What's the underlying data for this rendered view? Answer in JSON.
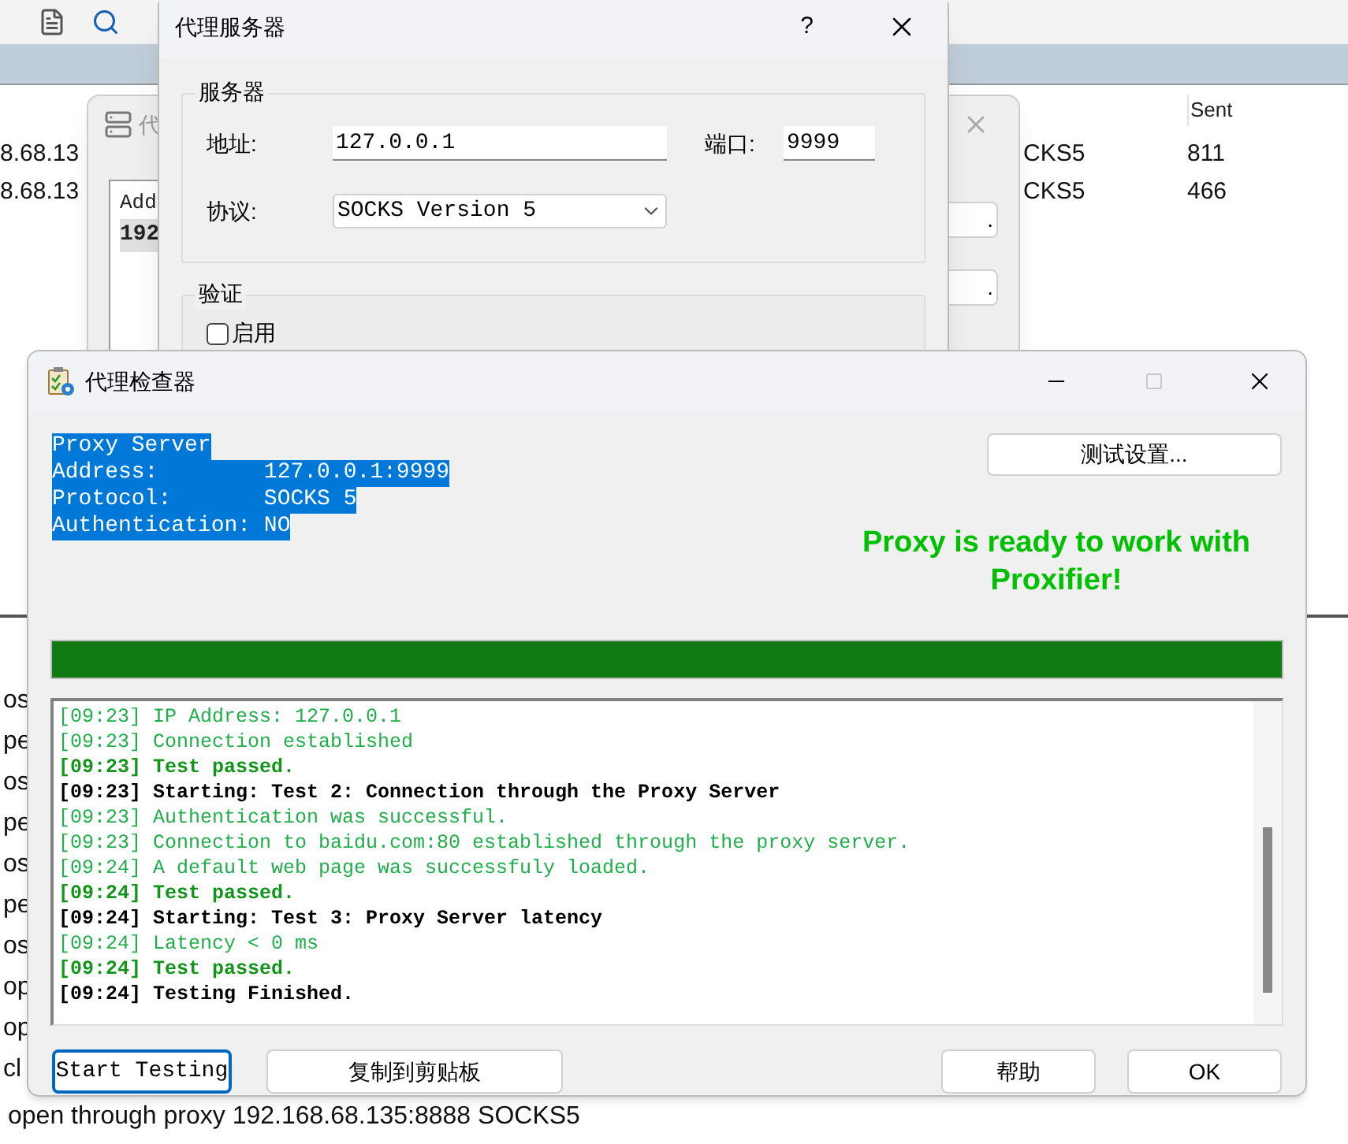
{
  "background_app": {
    "table": {
      "columns": [
        {
          "label": "Sent"
        }
      ],
      "rows": [
        {
          "address": "8.68.13",
          "protocol": "CKS5",
          "sent": "811"
        },
        {
          "address": "8.68.13",
          "protocol": "CKS5",
          "sent": "466"
        }
      ]
    },
    "log_fragments": [
      "os",
      "pe",
      "os",
      "pe",
      "os",
      "pe",
      "os",
      "op",
      "op",
      "cl"
    ],
    "log_last_line": "open through proxy 192.168.68.135:8888 SOCKS5"
  },
  "behind_window": {
    "title": "代",
    "list_lines": [
      "Add",
      "192"
    ],
    "buttons": [
      ".",
      "."
    ]
  },
  "proxy_server_dialog": {
    "title": "代理服务器",
    "help": "?",
    "server_group": {
      "title": "服务器",
      "address_label": "地址:",
      "address": "127.0.0.1",
      "port_label": "端口:",
      "port": "9999",
      "protocol_label": "协议:",
      "protocol": "SOCKS Version 5"
    },
    "auth_group": {
      "title": "验证",
      "enable_label": "启用",
      "enabled": false
    }
  },
  "checker": {
    "title": "代理检查器",
    "summary": {
      "selected": true,
      "lines": [
        "Proxy Server",
        "Address:        127.0.0.1:9999",
        "Protocol:       SOCKS 5",
        "Authentication: NO"
      ]
    },
    "settings_button": "测试设置...",
    "status": "Proxy is ready to work with Proxifier!",
    "progress": {
      "level": 1
    },
    "log": [
      {
        "time": "[09:23]",
        "text": "IP Address: 127.0.0.1",
        "kind": "info"
      },
      {
        "time": "[09:23]",
        "text": "Connection established",
        "kind": "info"
      },
      {
        "time": "[09:23]",
        "text": "Test passed.",
        "kind": "success"
      },
      {
        "time": "[09:23]",
        "text": "Starting: Test 2: Connection through the Proxy Server",
        "kind": "step"
      },
      {
        "time": "[09:23]",
        "text": "Authentication was successful.",
        "kind": "info"
      },
      {
        "time": "[09:23]",
        "text": "Connection to baidu.com:80 established through the proxy server.",
        "kind": "info"
      },
      {
        "time": "[09:24]",
        "text": "A default web page was successfuly loaded.",
        "kind": "info"
      },
      {
        "time": "[09:24]",
        "text": "Test passed.",
        "kind": "success"
      },
      {
        "time": "[09:24]",
        "text": "Starting: Test 3: Proxy Server latency",
        "kind": "step"
      },
      {
        "time": "[09:24]",
        "text": "Latency < 0 ms",
        "kind": "info"
      },
      {
        "time": "[09:24]",
        "text": "Test passed.",
        "kind": "success"
      },
      {
        "time": "[09:24]",
        "text": "Testing Finished.",
        "kind": "step"
      }
    ],
    "buttons_left": [
      {
        "label": "Start Testing",
        "focused": true
      },
      {
        "label": "复制到剪贴板",
        "focused": false
      }
    ],
    "buttons_right": [
      {
        "label": "帮助",
        "focused": false
      },
      {
        "label": "OK",
        "focused": false
      }
    ]
  }
}
